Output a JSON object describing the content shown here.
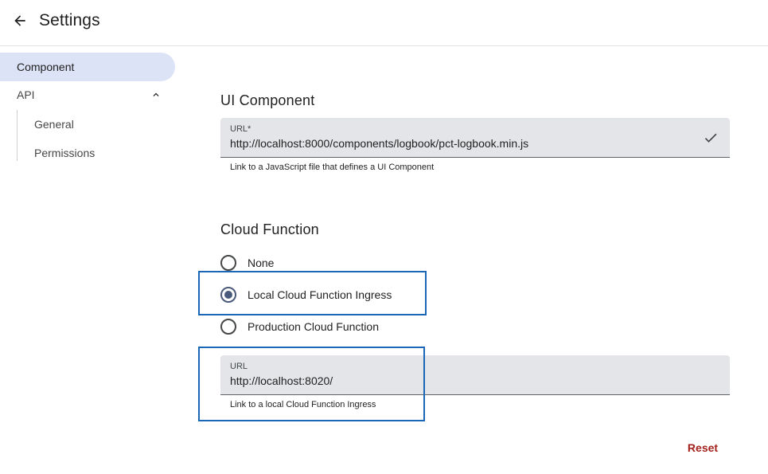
{
  "header": {
    "title": "Settings",
    "back_icon": "arrow-back-icon"
  },
  "sidebar": {
    "items": [
      {
        "label": "Component",
        "active": true
      },
      {
        "label": "API",
        "expanded": true,
        "children": [
          {
            "label": "General"
          },
          {
            "label": "Permissions"
          }
        ]
      }
    ],
    "chevron_icon": "chevron-up-icon"
  },
  "ui_component": {
    "title": "UI Component",
    "url_label": "URL*",
    "url_value": "http://localhost:8000/components/logbook/pct-logbook.min.js",
    "valid_icon": "check-icon",
    "hint": "Link to a JavaScript file that defines a UI Component"
  },
  "cloud_function": {
    "title": "Cloud Function",
    "options": [
      {
        "label": "None",
        "checked": false
      },
      {
        "label": "Local Cloud Function Ingress",
        "checked": true
      },
      {
        "label": "Production Cloud Function",
        "checked": false
      }
    ],
    "url_label": "URL",
    "url_value": "http://localhost:8020/",
    "hint": "Link to a local Cloud Function Ingress"
  },
  "actions": {
    "reset_label": "Reset"
  },
  "colors": {
    "accent": "#1a67b8",
    "active_nav": "#dde3f6",
    "reset": "#a3201b",
    "field_bg": "#e3e5e8"
  }
}
